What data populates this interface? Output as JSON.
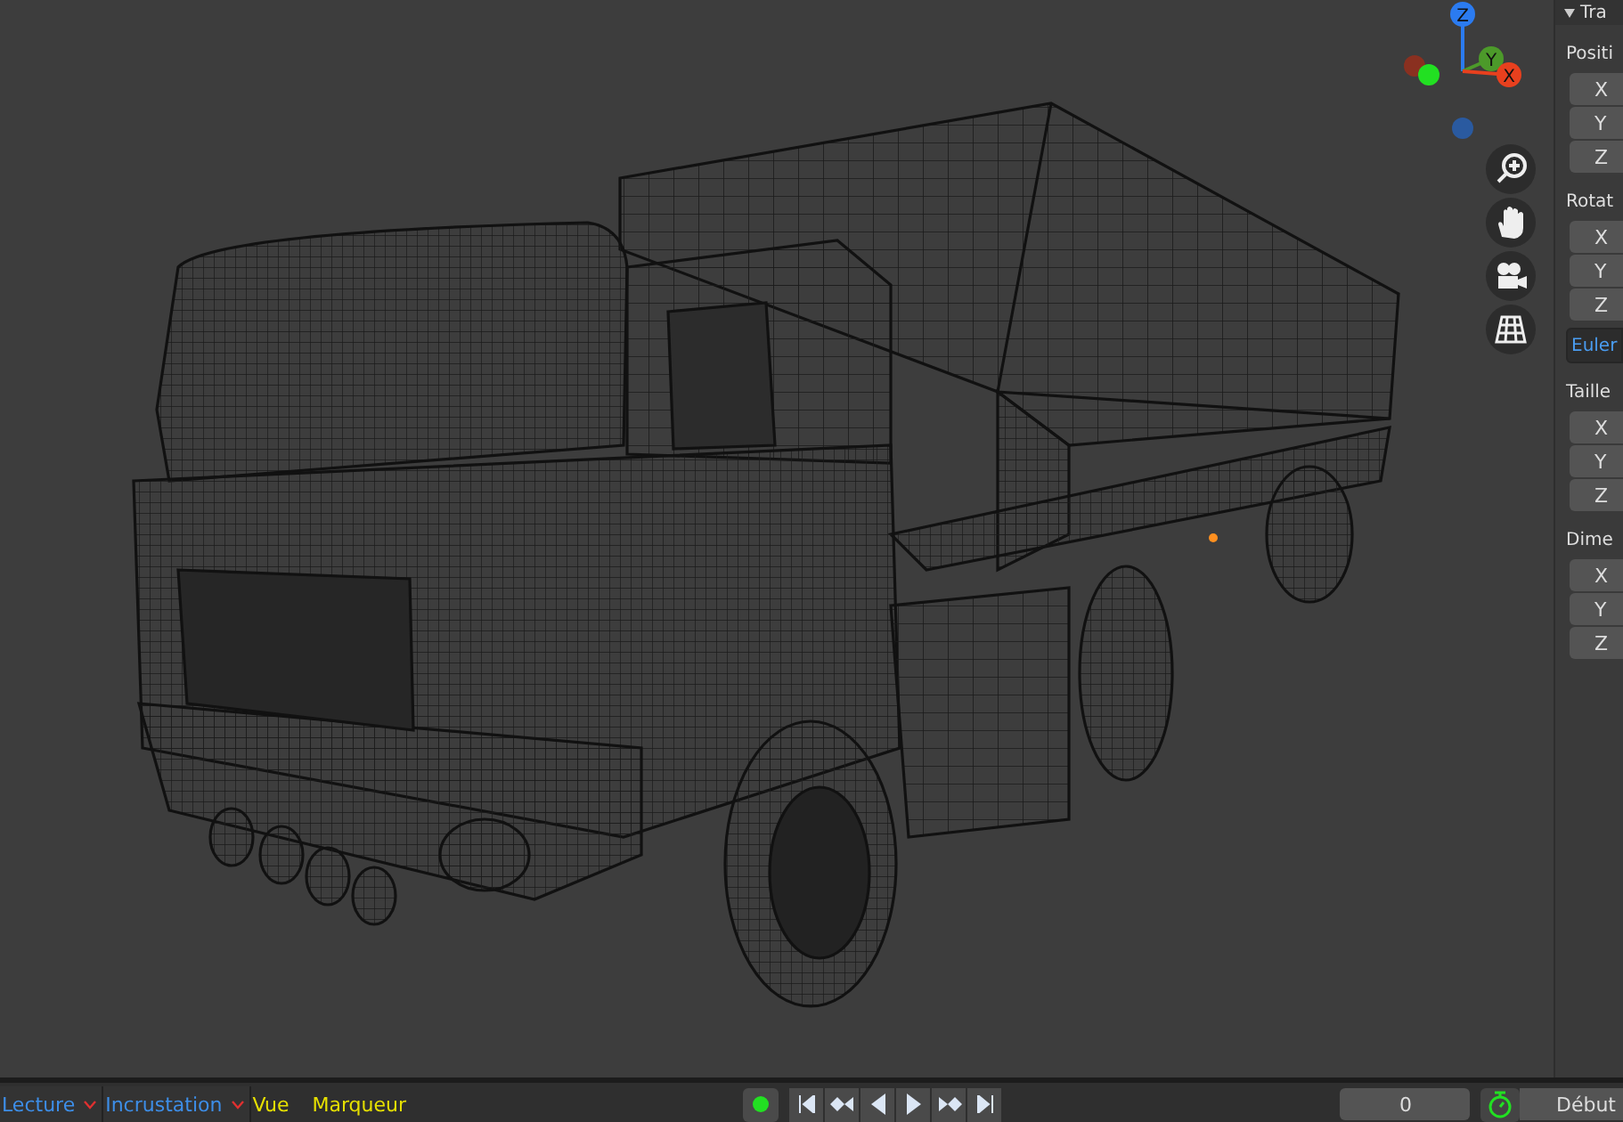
{
  "viewport": {
    "gizmo": {
      "axes": [
        {
          "label": "Z",
          "color": "#2b7bf0"
        },
        {
          "label": "Y",
          "color": "#4c9a2a"
        },
        {
          "label": "X",
          "color": "#e8401e"
        }
      ]
    }
  },
  "properties": {
    "header": "Tra",
    "groups": [
      {
        "label": "Positi",
        "fields": [
          "X",
          "Y",
          "Z"
        ]
      },
      {
        "label": "Rotat",
        "fields": [
          "X",
          "Y",
          "Z"
        ],
        "dropdown": "Euler"
      },
      {
        "label": "Taille",
        "fields": [
          "X",
          "Y",
          "Z"
        ]
      },
      {
        "label": "Dime",
        "fields": [
          "X",
          "Y",
          "Z"
        ]
      }
    ]
  },
  "timeline": {
    "menus": [
      {
        "label": "Lecture",
        "kind": "dropdown"
      },
      {
        "label": "Incrustation",
        "kind": "dropdown"
      },
      {
        "label": "Vue",
        "kind": "menu"
      },
      {
        "label": "Marqueur",
        "kind": "menu"
      }
    ],
    "current_frame": "0",
    "start_label": "Début"
  }
}
